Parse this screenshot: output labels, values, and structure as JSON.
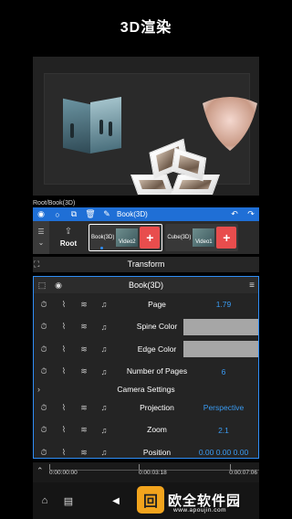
{
  "promo_title": "3D渲染",
  "breadcrumb": "Root/Book(3D)",
  "toolbar": {
    "title": "Book(3D)"
  },
  "layers": {
    "root_label": "Root",
    "cards": [
      {
        "name": "Book(3D)",
        "clip": "Video2",
        "selected": true
      },
      {
        "name": "Cube(3D)",
        "clip": "Video1",
        "selected": false
      }
    ]
  },
  "transform_label": "Transform",
  "panel": {
    "title": "Book(3D)",
    "rows": [
      {
        "label": "Page",
        "value": "1.79"
      },
      {
        "label": "Spine Color",
        "value": ""
      },
      {
        "label": "Edge Color",
        "value": ""
      },
      {
        "label": "Number of Pages",
        "value": "6"
      }
    ],
    "section_title": "Camera Settings",
    "camera_rows": [
      {
        "label": "Projection",
        "value": "Perspective"
      },
      {
        "label": "Zoom",
        "value": "2.1"
      },
      {
        "label": "Position",
        "value": "0.00   0.00   0.00"
      }
    ]
  },
  "timeline": {
    "t_start": "0:00:00:00",
    "t_mid": "0:00:03:18",
    "t_end": "0:00:07:06"
  },
  "watermark": {
    "text": "欧全软件园",
    "url": "www.apoujin.com"
  },
  "colors": {
    "accent": "#1f6fd6",
    "value_text": "#3a9bf2",
    "add_button": "#e84d4d",
    "swatch": "#a6a6a6"
  }
}
